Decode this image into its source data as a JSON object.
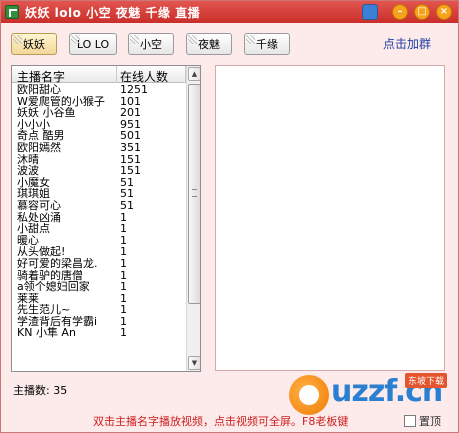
{
  "window": {
    "title": "妖妖 lolo 小空 夜魅 千缘 直播"
  },
  "toolbar": {
    "buttons": [
      {
        "label": "妖妖"
      },
      {
        "label": "LO LO"
      },
      {
        "label": "小空"
      },
      {
        "label": "夜魅"
      },
      {
        "label": "千缘"
      }
    ],
    "join_group_link": "点击加群"
  },
  "streamer_list": {
    "columns": [
      "主播名字",
      "在线人数"
    ],
    "rows": [
      {
        "name": "欧阳甜心",
        "count": "1251"
      },
      {
        "name": "W爱爬管的小猴子",
        "count": "101"
      },
      {
        "name": "妖妖 小谷鱼",
        "count": "201"
      },
      {
        "name": "小小小",
        "count": "951"
      },
      {
        "name": "奇点 酷男",
        "count": "501"
      },
      {
        "name": "欧阳嫣然",
        "count": "351"
      },
      {
        "name": "沐晴",
        "count": "151"
      },
      {
        "name": "波波",
        "count": "151"
      },
      {
        "name": "小魔女",
        "count": "51"
      },
      {
        "name": "琪琪姐",
        "count": "51"
      },
      {
        "name": "慕容可心",
        "count": "51"
      },
      {
        "name": "私处凶涌",
        "count": "1"
      },
      {
        "name": "小甜点",
        "count": "1"
      },
      {
        "name": "暖心",
        "count": "1"
      },
      {
        "name": "从头做起!",
        "count": "1"
      },
      {
        "name": "好可爱的梁昌龙.",
        "count": "1"
      },
      {
        "name": "骑着驴的唐僧",
        "count": "1"
      },
      {
        "name": "a领个媳妇回家",
        "count": "1"
      },
      {
        "name": "莱莱",
        "count": "1"
      },
      {
        "name": "先生范儿~",
        "count": "1"
      },
      {
        "name": "学渣背后有学霸i",
        "count": "1"
      },
      {
        "name": "KN 小隼 An",
        "count": "1"
      }
    ]
  },
  "footer": {
    "streamer_count": "主播数: 35",
    "hint": "双击主播名字播放视频，点击视频可全屏。F8老板键",
    "topmost_label": "置顶"
  },
  "watermark": {
    "text": "uzzf.cn",
    "badge": "东坡下载"
  },
  "colors": {
    "titlebar": "#c92e2a",
    "window_bg": "#fdeaea",
    "hint_text": "#cc1f1f",
    "link": "#1f3fa5"
  }
}
